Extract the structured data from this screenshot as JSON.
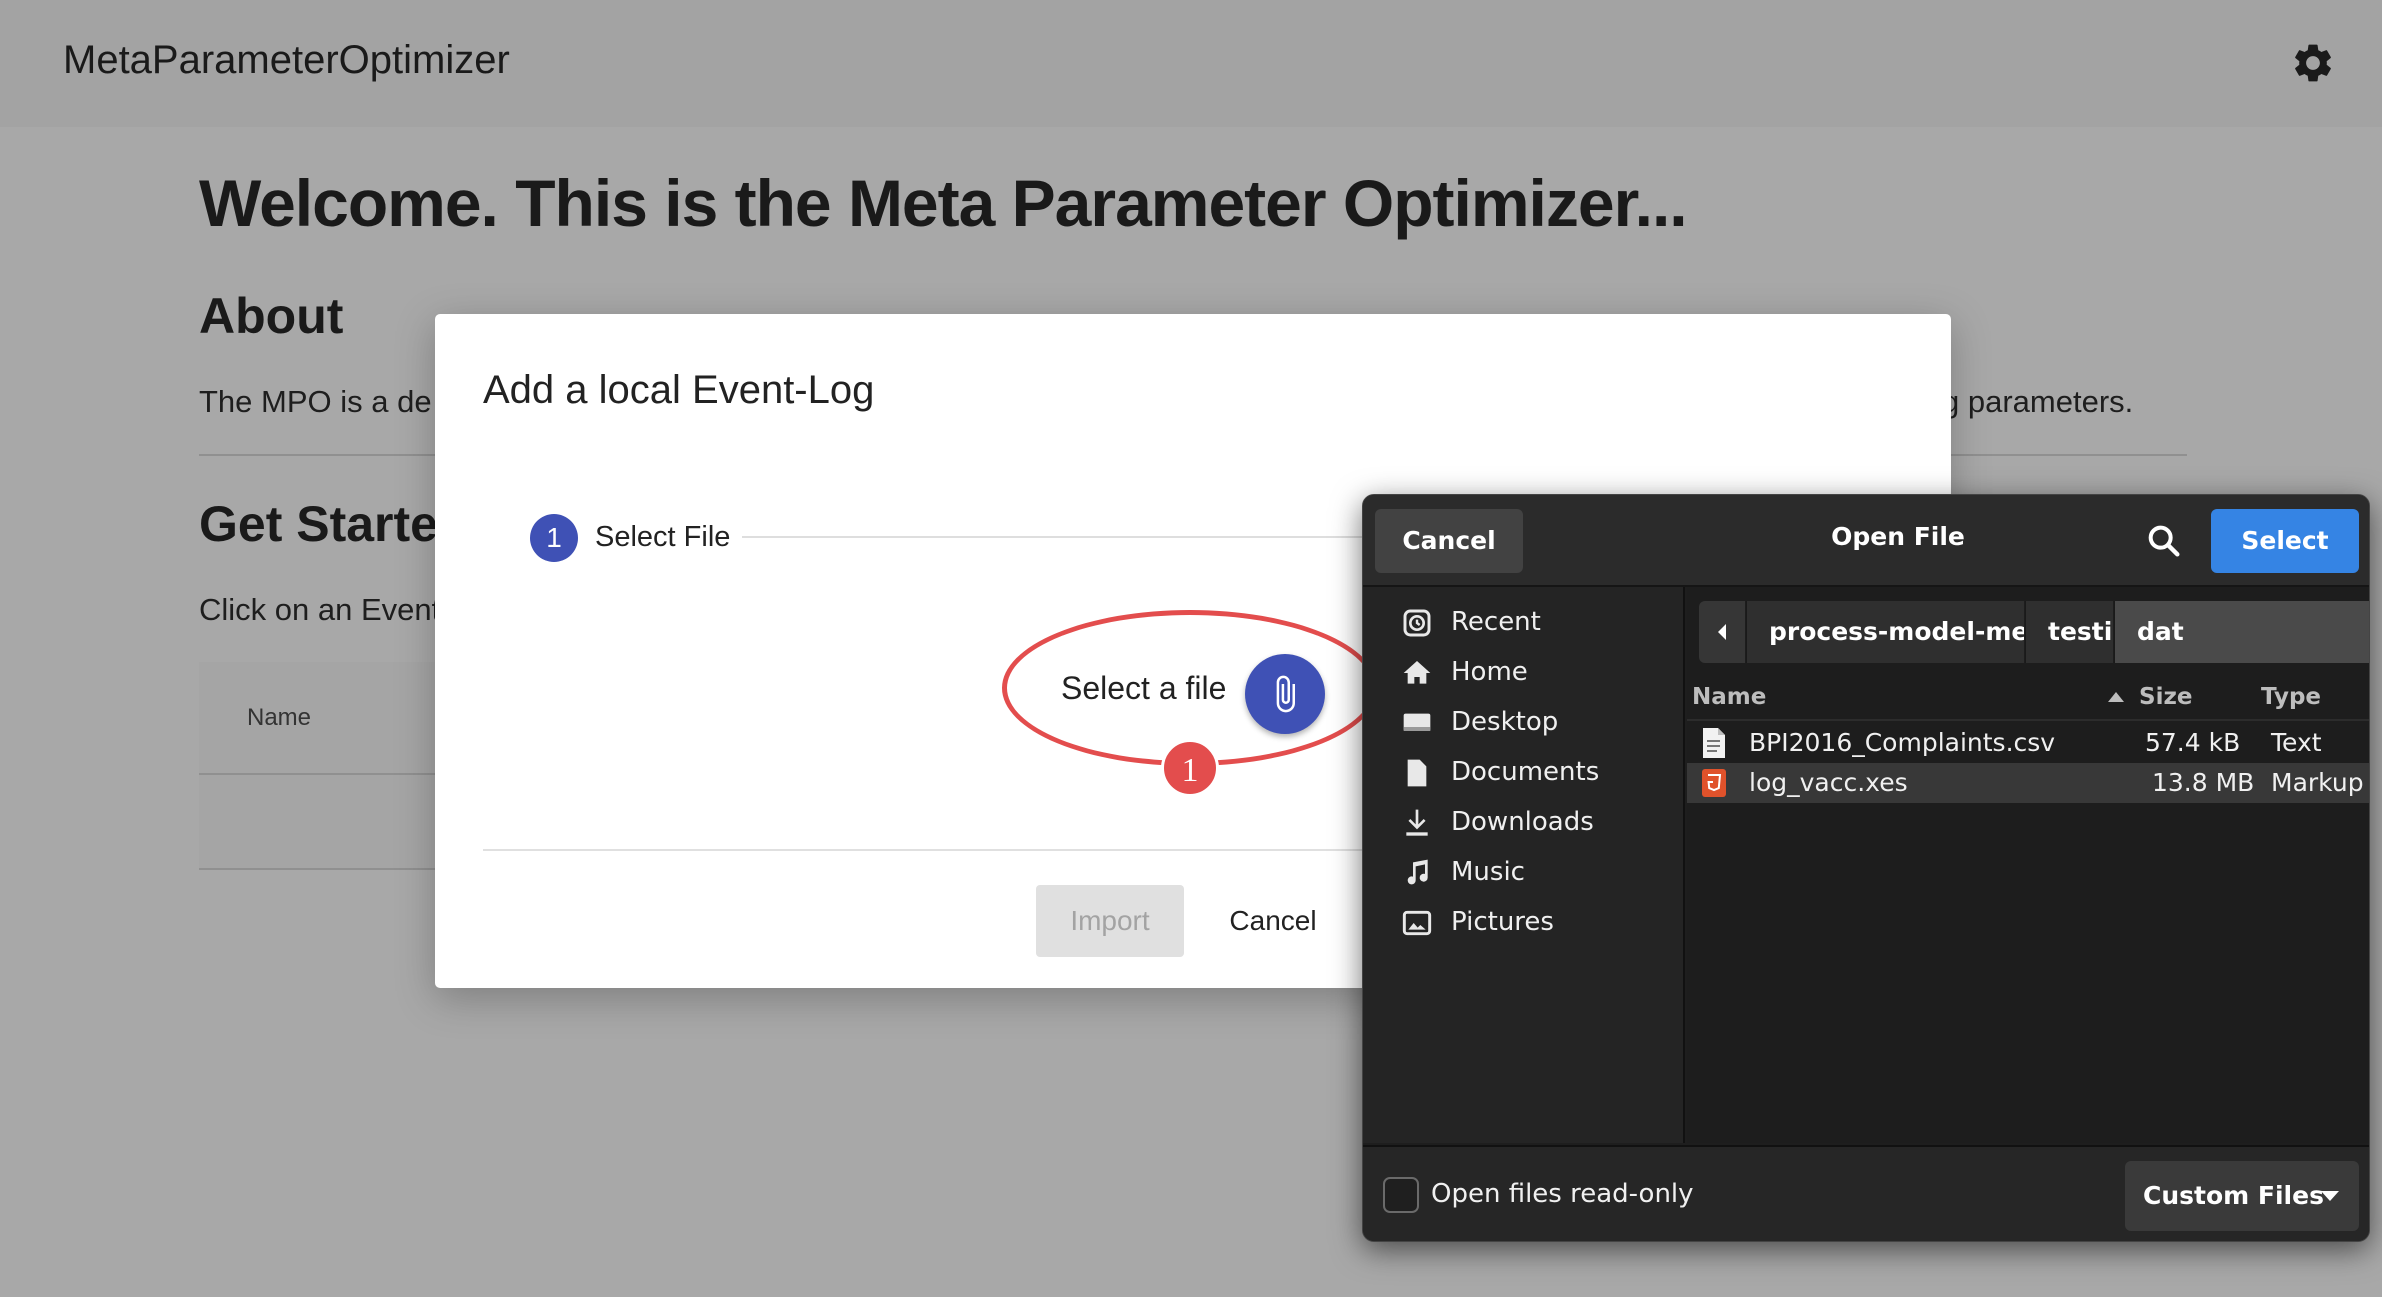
{
  "app": {
    "title": "MetaParameterOptimizer",
    "welcome": "Welcome. This is the Meta Parameter Optimizer...",
    "about_heading": "About",
    "about_text_visible_start": "The MPO is a de",
    "about_text_visible_end": "g parameters.",
    "get_started_heading": "Get Started",
    "get_started_text_visible": "Click on an Event",
    "table_header_name": "Name"
  },
  "modal": {
    "title": "Add a local Event-Log",
    "step_number": "1",
    "step_label": "Select File",
    "select_file_text": "Select a file",
    "annotation_number": "1",
    "import_label": "Import",
    "cancel_label": "Cancel"
  },
  "file_chooser": {
    "cancel_label": "Cancel",
    "title": "Open File",
    "select_label": "Select",
    "sidebar": [
      {
        "label": "Recent",
        "icon": "recent-icon"
      },
      {
        "label": "Home",
        "icon": "home-icon"
      },
      {
        "label": "Desktop",
        "icon": "desktop-icon"
      },
      {
        "label": "Documents",
        "icon": "documents-icon"
      },
      {
        "label": "Downloads",
        "icon": "downloads-icon"
      },
      {
        "label": "Music",
        "icon": "music-icon"
      },
      {
        "label": "Pictures",
        "icon": "pictures-icon"
      }
    ],
    "path": [
      "process-model-meta-discovery",
      "testing",
      "dat"
    ],
    "columns": {
      "name": "Name",
      "size": "Size",
      "type": "Type"
    },
    "files": [
      {
        "name": "BPI2016_Complaints.csv",
        "size": "57.4 kB",
        "type": "Text",
        "icon": "text-file-icon"
      },
      {
        "name": "log_vacc.xes",
        "size": "13.8 MB",
        "type": "Markup",
        "icon": "html-file-icon"
      }
    ],
    "read_only_label": "Open files read-only",
    "read_only_checked": false,
    "filter_label": "Custom Files"
  },
  "colors": {
    "primary": "#3f51b5",
    "annotation": "#e34d4d",
    "gtk_accent": "#3584e4"
  }
}
